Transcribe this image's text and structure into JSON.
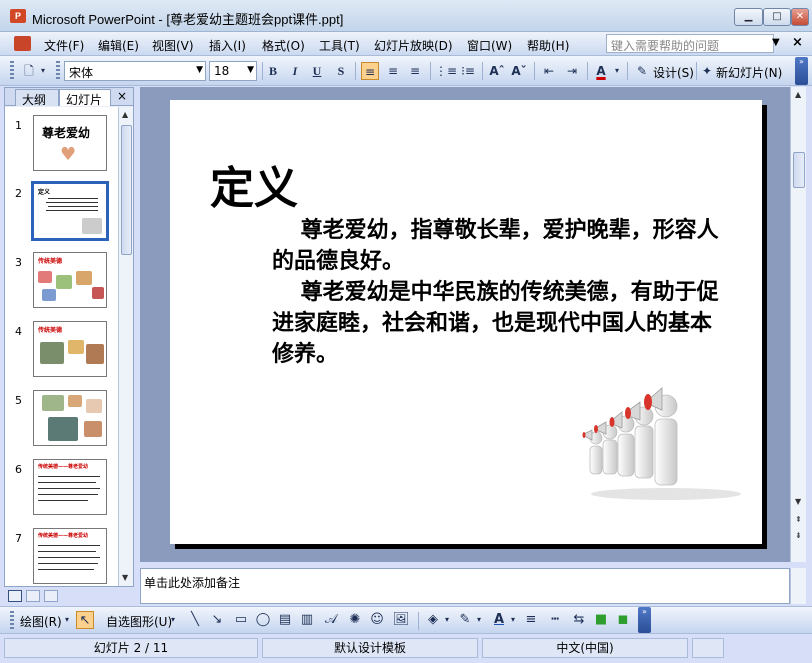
{
  "window": {
    "title": "Microsoft PowerPoint - [尊老爱幼主题班会ppt课件.ppt]",
    "minimize": "▁",
    "maximize": "□",
    "close": "✕"
  },
  "menu": {
    "items": [
      "文件(F)",
      "编辑(E)",
      "视图(V)",
      "插入(I)",
      "格式(O)",
      "工具(T)",
      "幻灯片放映(D)",
      "窗口(W)",
      "帮助(H)"
    ],
    "help_placeholder": "键入需要帮助的问题"
  },
  "toolbar": {
    "font_name": "宋体",
    "font_size": "18",
    "bold": "B",
    "italic": "I",
    "underline": "U",
    "shadow": "S",
    "font_color_label": "A",
    "design_label": "设计(S)",
    "new_slide_label": "新幻灯片(N)"
  },
  "left_pane": {
    "tab_outline": "大纲",
    "tab_slides": "幻灯片",
    "close": "×",
    "slides": [
      {
        "num": "1",
        "title": "尊老爱幼"
      },
      {
        "num": "2",
        "title": "定义"
      },
      {
        "num": "3",
        "title": "传统美德"
      },
      {
        "num": "4",
        "title": "传统美德"
      },
      {
        "num": "5",
        "title": ""
      },
      {
        "num": "6",
        "title": "传统美德——尊老爱幼"
      },
      {
        "num": "7",
        "title": "传统美德——尊老爱幼"
      }
    ]
  },
  "slide": {
    "title": "定义",
    "paragraphs": [
      "尊老爱幼，指尊敬长辈，爱护晚辈，形容人的品德良好。",
      "尊老爱幼是中华民族的传统美德，有助于促进家庭睦，社会和谐，也是现代中国人的基本修养。"
    ]
  },
  "notes": {
    "placeholder": "单击此处添加备注"
  },
  "drawing_toolbar": {
    "draw_label": "绘图(R)",
    "autoshapes_label": "自选图形(U)"
  },
  "status": {
    "slide_position": "幻灯片 2 / 11",
    "template": "默认设计模板",
    "language": "中文(中国)"
  }
}
